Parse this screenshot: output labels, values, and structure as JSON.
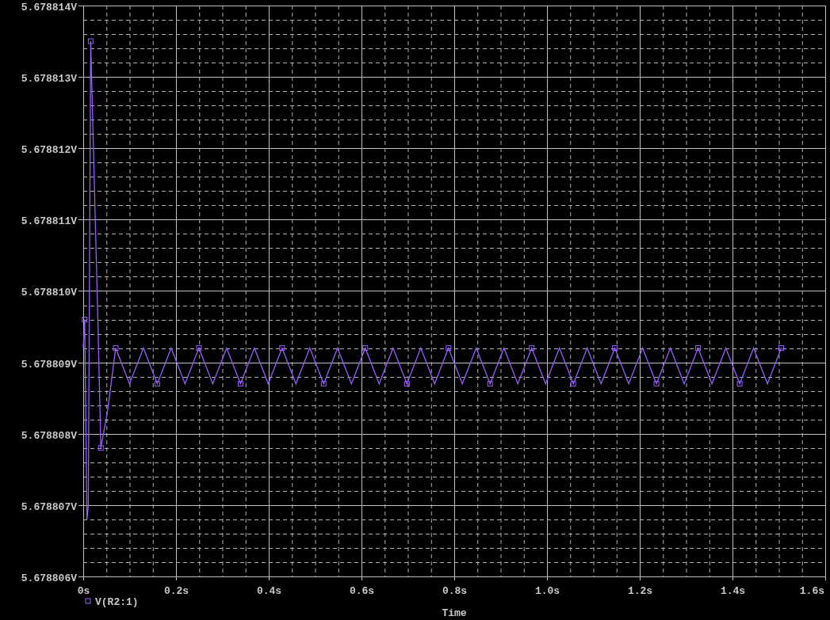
{
  "chart_data": {
    "type": "line",
    "grid": true,
    "xlabel": "Time",
    "xlim": [
      0,
      1.6
    ],
    "ylim": [
      5.678806,
      5.678814
    ],
    "xticks": [
      {
        "value": 0,
        "label": "0s"
      },
      {
        "value": 0.2,
        "label": "0.2s"
      },
      {
        "value": 0.4,
        "label": "0.4s"
      },
      {
        "value": 0.6,
        "label": "0.6s"
      },
      {
        "value": 0.8,
        "label": "0.8s"
      },
      {
        "value": 1.0,
        "label": "1.0s"
      },
      {
        "value": 1.2,
        "label": "1.2s"
      },
      {
        "value": 1.4,
        "label": "1.4s"
      },
      {
        "value": 1.6,
        "label": "1.6s"
      }
    ],
    "yticks": [
      {
        "value": 5.678806,
        "label": "5.678806V"
      },
      {
        "value": 5.678807,
        "label": "5.678807V"
      },
      {
        "value": 5.678808,
        "label": "5.678808V"
      },
      {
        "value": 5.678809,
        "label": "5.678809V"
      },
      {
        "value": 5.67881,
        "label": "5.678810V"
      },
      {
        "value": 5.678811,
        "label": "5.678811V"
      },
      {
        "value": 5.678812,
        "label": "5.678812V"
      },
      {
        "value": 5.678813,
        "label": "5.678813V"
      },
      {
        "value": 5.678814,
        "label": "5.678814V"
      }
    ],
    "x": [
      0,
      0.003,
      0.008,
      0.011,
      0.016,
      0.024,
      0.032,
      0.038,
      0.052,
      0.062,
      0.07,
      0.0999,
      0.1298,
      0.1597,
      0.1896,
      0.2195,
      0.2494,
      0.2793,
      0.3092,
      0.3391,
      0.369,
      0.3989,
      0.4288,
      0.4587,
      0.4886,
      0.5185,
      0.5484,
      0.5783,
      0.6082,
      0.6381,
      0.668,
      0.6979,
      0.7278,
      0.7577,
      0.7876,
      0.8175,
      0.8474,
      0.8773,
      0.9072,
      0.9371,
      0.967,
      0.9969,
      1.0268,
      1.0567,
      1.0866,
      1.1165,
      1.1464,
      1.1763,
      1.2062,
      1.2361,
      1.266,
      1.2959,
      1.3258,
      1.3557,
      1.3856,
      1.4155,
      1.4454,
      1.4753,
      1.5052
    ],
    "series": [
      {
        "name": "V(R2:1)",
        "color": "#9a5cff",
        "values": [
          5.6788092,
          5.6788096,
          5.6788068,
          5.678807,
          5.6788135,
          5.6788115,
          5.6788095,
          5.6788078,
          5.6788083,
          5.6788088,
          5.6788092,
          5.6788087,
          5.6788092,
          5.6788087,
          5.6788092,
          5.6788087,
          5.6788092,
          5.6788087,
          5.6788092,
          5.6788087,
          5.6788092,
          5.6788087,
          5.6788092,
          5.6788087,
          5.6788092,
          5.6788087,
          5.6788092,
          5.6788087,
          5.6788092,
          5.6788087,
          5.6788092,
          5.6788087,
          5.6788092,
          5.6788087,
          5.6788092,
          5.6788087,
          5.6788092,
          5.6788087,
          5.6788092,
          5.6788087,
          5.6788092,
          5.6788087,
          5.6788092,
          5.6788087,
          5.6788092,
          5.6788087,
          5.6788092,
          5.6788087,
          5.6788092,
          5.6788087,
          5.6788092,
          5.6788087,
          5.6788092,
          5.6788087,
          5.6788092,
          5.6788087,
          5.6788092,
          5.6788087,
          5.6788092
        ]
      }
    ]
  }
}
